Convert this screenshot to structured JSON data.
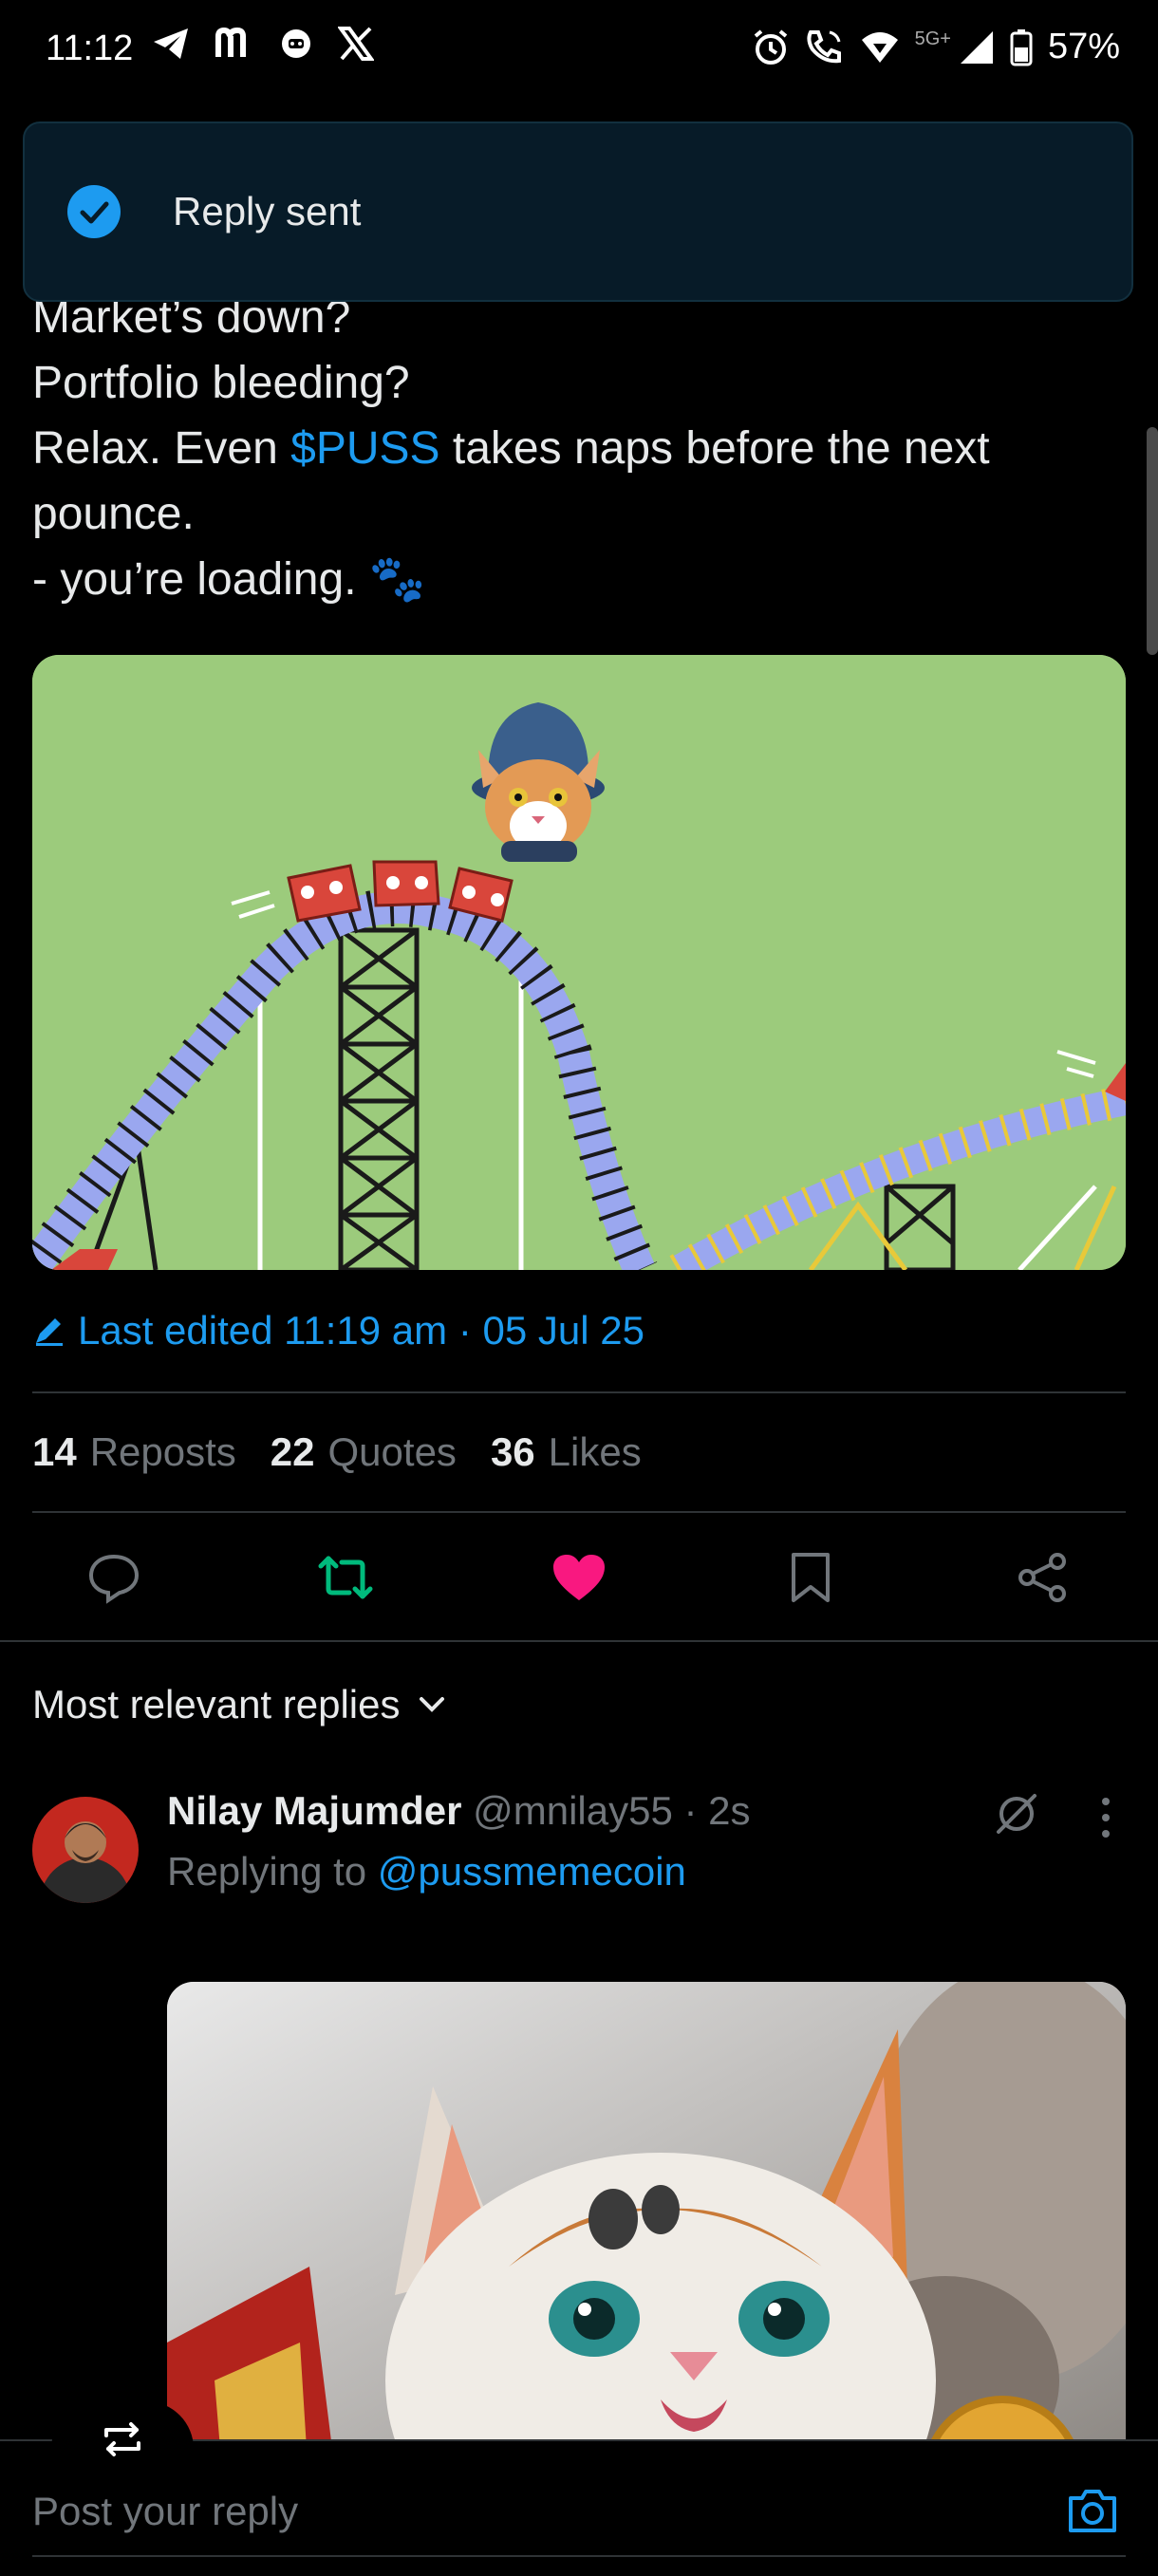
{
  "status_bar": {
    "time": "11:12",
    "network": "5G+",
    "battery": "57%",
    "left_icons": [
      "telegram-icon",
      "m-app-icon",
      "ghost-icon",
      "x-icon"
    ],
    "right_icons": [
      "alarm-icon",
      "call-icon",
      "wifi-icon",
      "signal-icon",
      "battery-icon"
    ]
  },
  "toast": {
    "text": "Reply sent",
    "icon": "check-circle-icon",
    "color": "#1d9bf0"
  },
  "tweet": {
    "lines": {
      "l1": "Market’s down?",
      "l2": "Portfolio bleeding?",
      "l3_pre": "Relax. Even ",
      "l3_tag": "$PUSS",
      "l3_post": " takes naps before the next",
      "l4": "pounce.",
      "l5": "- you’re loading. 🐾"
    },
    "edited": "Last edited 11:19 am · 05 Jul 25",
    "stats": {
      "reposts_count": "14",
      "reposts_label": "Reposts",
      "quotes_count": "22",
      "quotes_label": "Quotes",
      "likes_count": "36",
      "likes_label": "Likes"
    },
    "actions": [
      "reply-icon",
      "repost-icon",
      "like-icon",
      "bookmark-icon",
      "share-icon"
    ],
    "repost_color": "#00ba7c",
    "like_color": "#f91880"
  },
  "replies": {
    "sort_label": "Most relevant replies",
    "items": [
      {
        "name": "Nilay Majumder",
        "handle": "@mnilay55",
        "time": "· 2s",
        "replying_prefix": "Replying to ",
        "replying_handle": "@pussmemecoin"
      }
    ]
  },
  "compose": {
    "placeholder": "Post your reply"
  }
}
